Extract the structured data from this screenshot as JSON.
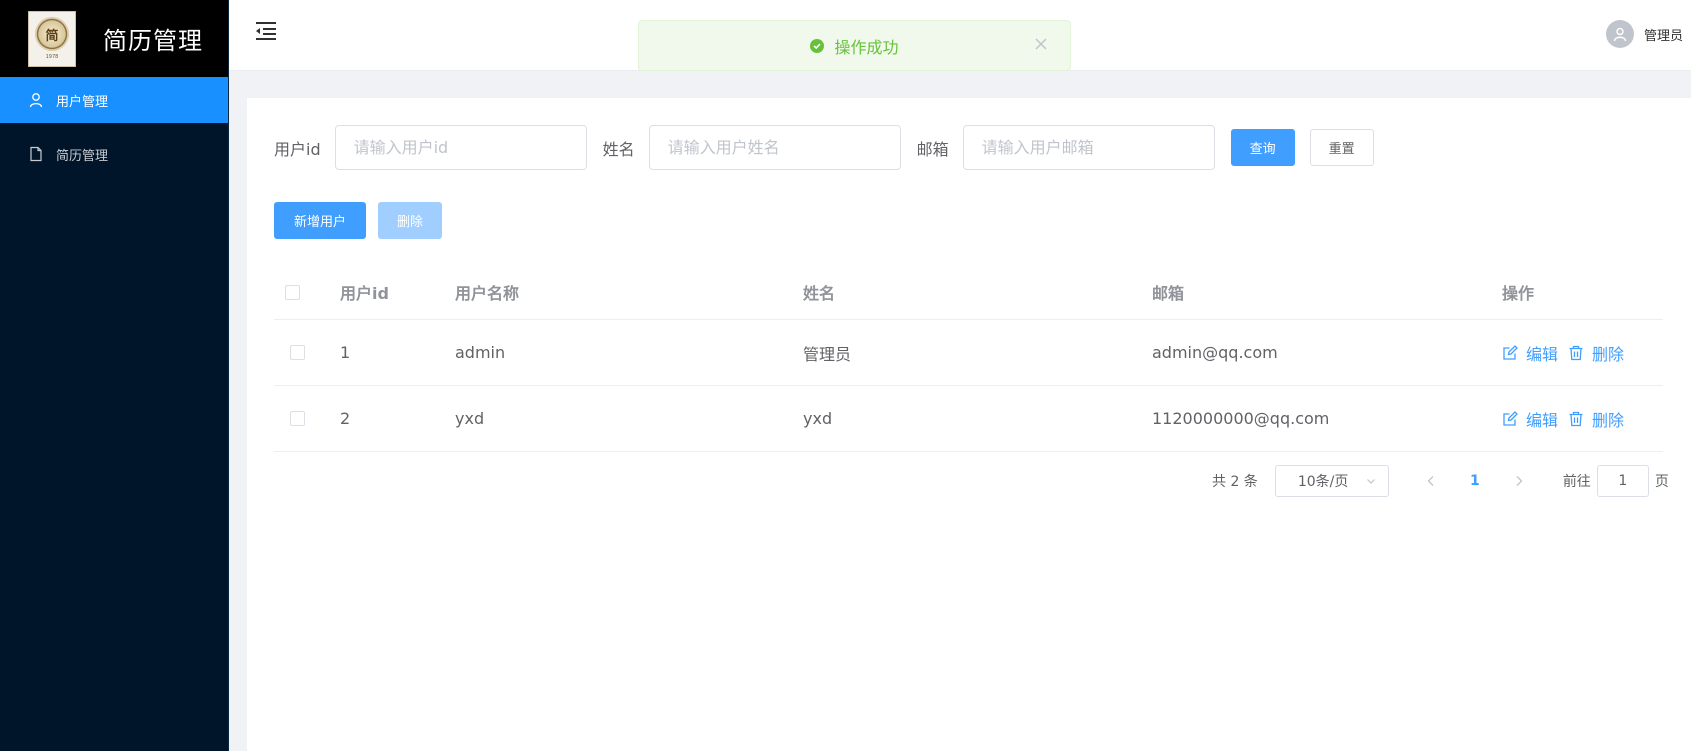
{
  "sidebar": {
    "logo_text": "简历管理",
    "logo_seal_char": "简",
    "logo_foot": "1978",
    "items": [
      {
        "label": "用户管理",
        "icon": "user-icon",
        "active": true
      },
      {
        "label": "简历管理",
        "icon": "document-icon",
        "active": false
      }
    ]
  },
  "header": {
    "user_name": "管理员"
  },
  "toast": {
    "message": "操作成功"
  },
  "search": {
    "fields": [
      {
        "label": "用户id",
        "placeholder": "请输入用户id"
      },
      {
        "label": "姓名",
        "placeholder": "请输入用户姓名"
      },
      {
        "label": "邮箱",
        "placeholder": "请输入用户邮箱"
      }
    ],
    "query_label": "查询",
    "reset_label": "重置"
  },
  "actions": {
    "add_label": "新增用户",
    "delete_label": "删除"
  },
  "table": {
    "columns": [
      "用户id",
      "用户名称",
      "姓名",
      "邮箱",
      "操作"
    ],
    "rows": [
      {
        "id": "1",
        "username": "admin",
        "name": "管理员",
        "email": "admin@qq.com"
      },
      {
        "id": "2",
        "username": "yxd",
        "name": "yxd",
        "email": "1120000000@qq.com"
      }
    ],
    "edit_label": "编辑",
    "delete_label": "删除"
  },
  "pagination": {
    "total": "共 2 条",
    "page_size": "10条/页",
    "current_page": "1",
    "goto_prefix": "前往",
    "goto_value": "1",
    "goto_suffix": "页"
  },
  "colors": {
    "sidebar_bg": "#001529",
    "active": "#1890ff",
    "primary": "#409eff",
    "success": "#67c23a"
  }
}
